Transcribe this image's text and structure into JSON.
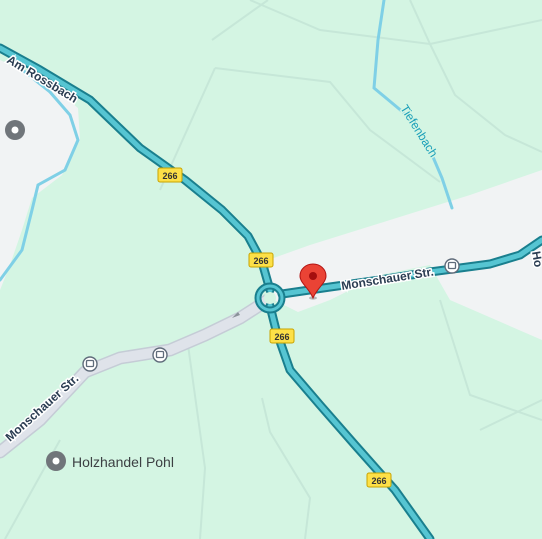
{
  "map": {
    "colors": {
      "land": "#d4f5e3",
      "urban": "#f1f3f4",
      "major_road_casing": "#1a7f8e",
      "major_road_fill": "#56c5d2",
      "minor_road": "#d5dbe3",
      "path": "#cfe6dd",
      "water": "#7fd0e6",
      "pin": "#ea4335",
      "shield_fill": "#fde047",
      "poi_gray": "#70757a"
    },
    "roads": {
      "am_rossbach": "Am Rossbach",
      "monschauer_east": "Monschauer Str.",
      "monschauer_west": "Monschauer Str.",
      "edge_label_right": "Ho"
    },
    "route_shields": [
      {
        "id": "shield-1",
        "label": "266"
      },
      {
        "id": "shield-2",
        "label": "266"
      },
      {
        "id": "shield-3",
        "label": "266"
      },
      {
        "id": "shield-4",
        "label": "266"
      }
    ],
    "waterway": {
      "label": "Tiefenbach"
    },
    "pois": {
      "place_1": {
        "label": "Holzhandel Pohl",
        "icon": "place-pin-icon"
      },
      "place_2": {
        "label": "",
        "icon": "place-pin-icon"
      }
    },
    "icons": {
      "bus_stops": [
        "bus-stop-icon",
        "bus-stop-icon",
        "bus-stop-icon"
      ],
      "selected": "red-location-pin-icon",
      "roundabout": "roundabout-icon"
    }
  }
}
